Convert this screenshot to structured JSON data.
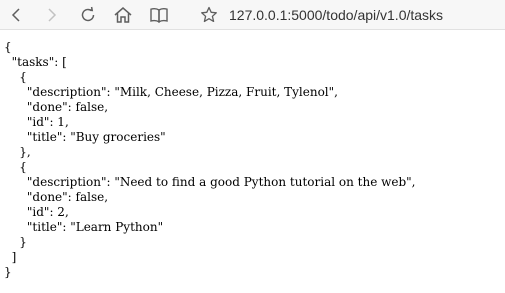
{
  "browser": {
    "url": "127.0.0.1:5000/todo/api/v1.0/tasks",
    "icons": {
      "back": "arrow-left-icon",
      "forward": "arrow-right-icon",
      "refresh": "refresh-icon",
      "home": "home-icon",
      "reader": "book-icon",
      "favorite": "star-icon"
    },
    "colors": {
      "toolbar_bg": "#f7f7f7",
      "icon": "#5f5f5f",
      "icon_disabled": "#c2c2c2"
    }
  },
  "document": {
    "text": "{\n  \"tasks\": [\n    {\n      \"description\": \"Milk, Cheese, Pizza, Fruit, Tylenol\",\n      \"done\": false,\n      \"id\": 1,\n      \"title\": \"Buy groceries\"\n    },\n    {\n      \"description\": \"Need to find a good Python tutorial on the web\",\n      \"done\": false,\n      \"id\": 2,\n      \"title\": \"Learn Python\"\n    }\n  ]\n}"
  }
}
